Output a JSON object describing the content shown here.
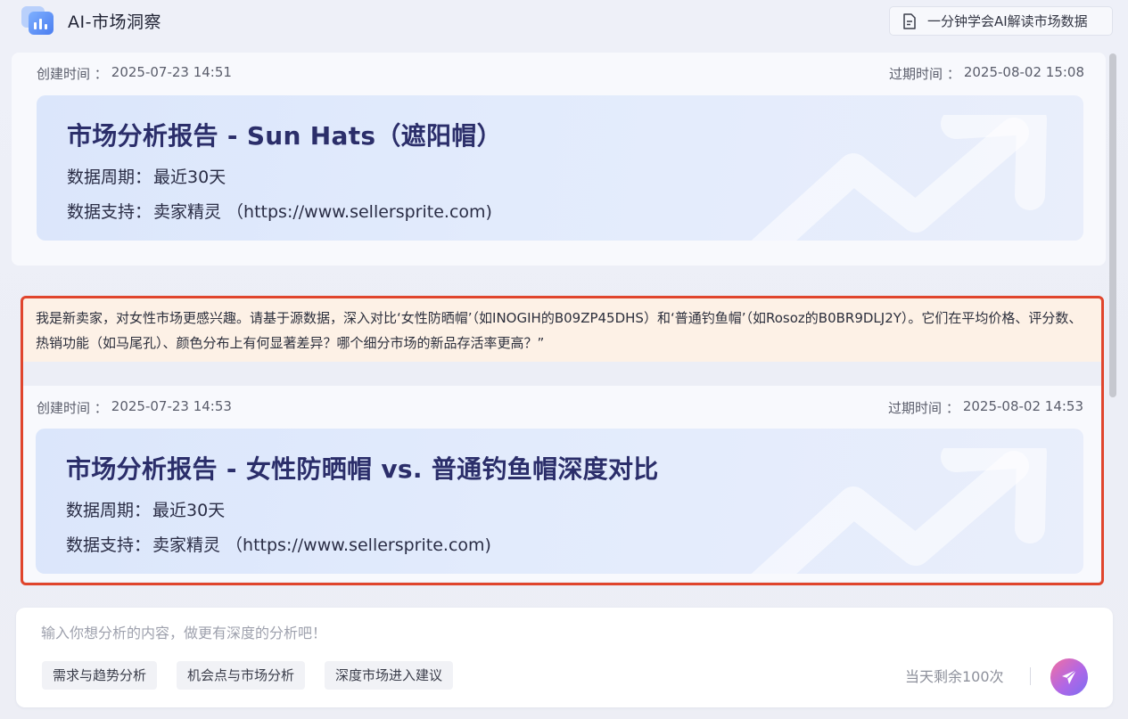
{
  "app": {
    "title": "AI-市场洞察",
    "guide_button_label": "一分钟学会AI解读市场数据"
  },
  "reports": [
    {
      "created_label": "创建时间 ：",
      "created_value": "2025-07-23 14:51",
      "expire_label": "过期时间 ：",
      "expire_value": "2025-08-02 15:08",
      "title": "市场分析报告 - Sun Hats（遮阳帽）",
      "period_label": "数据周期：",
      "period_value": "最近30天",
      "source_label": "数据支持：",
      "source_value": "卖家精灵 （https://www.sellersprite.com)"
    },
    {
      "query": "我是新卖家，对女性市场更感兴趣。请基于源数据，深入对比‘女性防晒帽’（如INOGIH的B09ZP45DHS）和‘普通钓鱼帽’（如Rosoz的B0BR9DLJ2Y）。它们在平均价格、评分数、热销功能（如马尾孔）、颜色分布上有何显著差异？哪个细分市场的新品存活率更高？”",
      "created_label": "创建时间 ：",
      "created_value": "2025-07-23 14:53",
      "expire_label": "过期时间 ：",
      "expire_value": "2025-08-02 14:53",
      "title": "市场分析报告 - 女性防晒帽 vs. 普通钓鱼帽深度对比",
      "period_label": "数据周期：",
      "period_value": "最近30天",
      "source_label": "数据支持：",
      "source_value": "卖家精灵 （https://www.sellersprite.com)"
    }
  ],
  "input": {
    "placeholder": "输入你想分析的内容，做更有深度的分析吧！",
    "chips": [
      "需求与趋势分析",
      "机会点与市场分析",
      "深度市场进入建议"
    ],
    "remaining": "当天剩余100次"
  },
  "colors": {
    "highlight_border": "#e0452d",
    "query_bg": "#fdf1e6",
    "title_color": "#2b2e6a",
    "send_gradient_start": "#f36fa0",
    "send_gradient_end": "#7a6ef2"
  },
  "icons": {
    "logo": "app-logo-icon",
    "guide": "document-icon",
    "send": "paper-plane-icon",
    "watermark": "trend-arrow-icon"
  }
}
